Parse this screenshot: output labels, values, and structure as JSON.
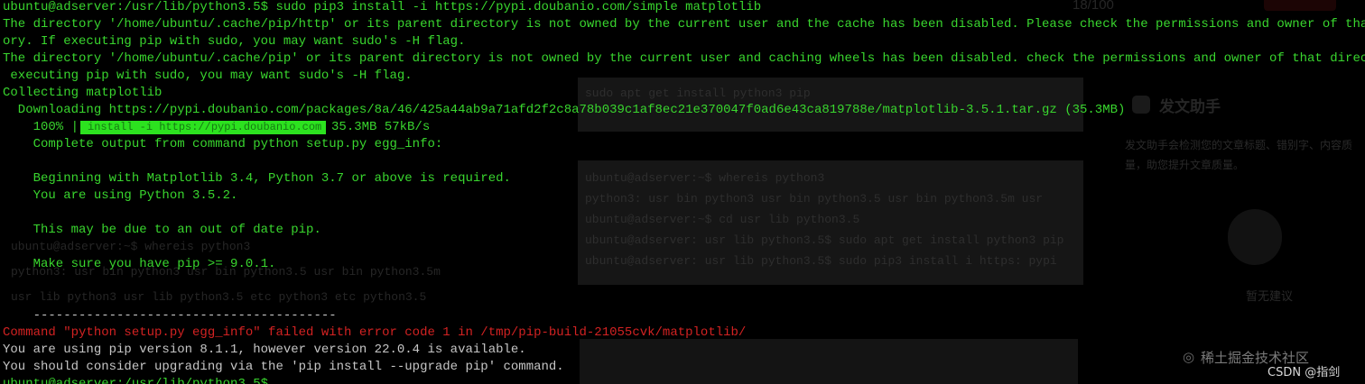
{
  "terminal": {
    "lines": [
      {
        "text": "ubuntu@adserver:/usr/lib/python3.5$ sudo pip3 install -i https://pypi.doubanio.com/simple matplotlib",
        "color": "#39d62e"
      },
      {
        "text": "The directory '/home/ubuntu/.cache/pip/http' or its parent directory is not owned by the current user and the cache has been disabled. Please check the permissions and owner of that direct",
        "color": "#39d62e"
      },
      {
        "text": "ory. If executing pip with sudo, you may want sudo's -H flag.",
        "color": "#39d62e"
      },
      {
        "text": "The directory '/home/ubuntu/.cache/pip' or its parent directory is not owned by the current user and caching wheels has been disabled. check the permissions and owner of that directo",
        "color": "#39d62e"
      },
      {
        "text": " executing pip with sudo, you may want sudo's -H flag.",
        "color": "#39d62e"
      },
      {
        "text": "Collecting matplotlib",
        "color": "#39d62e"
      },
      {
        "text": "  Downloading https://pypi.doubanio.com/packages/8a/46/425a44ab9a71afd2f2c8a78b039c1af8ec21e370047f0ad6e43ca819788e/matplotlib-3.5.1.tar.gz (35.3MB)",
        "color": "#39d62e"
      },
      {
        "text": "    Complete output from command python setup.py egg_info:",
        "color": "#39d62e"
      },
      {
        "text": "",
        "color": "#39d62e"
      },
      {
        "text": "    Beginning with Matplotlib 3.4, Python 3.7 or above is required.",
        "color": "#39d62e"
      },
      {
        "text": "    You are using Python 3.5.2.",
        "color": "#39d62e"
      },
      {
        "text": "",
        "color": "#39d62e"
      },
      {
        "text": "    This may be due to an out of date pip.",
        "color": "#39d62e"
      },
      {
        "text": "",
        "color": "#39d62e"
      },
      {
        "text": "    Make sure you have pip >= 9.0.1.",
        "color": "#39d62e"
      },
      {
        "text": "",
        "color": "#39d62e"
      },
      {
        "text": "    ----------------------------------------",
        "color": "#c6c6c6"
      },
      {
        "text": "Command \"python setup.py egg_info\" failed with error code 1 in /tmp/pip-build-21055cvk/matplotlib/",
        "color": "#d32222"
      },
      {
        "text": "You are using pip version 8.1.1, however version 22.0.4 is available.",
        "color": "#c6c6c6"
      },
      {
        "text": "You should consider upgrading via the 'pip install --upgrade pip' command.",
        "color": "#c6c6c6"
      },
      {
        "text": "ubuntu@adserver:/usr/lib/python3.5$",
        "color": "#39d62e"
      }
    ],
    "progress": {
      "percent_label": "    100% |",
      "fraction": 1.0,
      "overlay_text": "install -i https://pypi.doubanio.com",
      "size_speed": "35.3MB 57kB/s"
    }
  },
  "background_window": {
    "top_counter": "18/100",
    "code_lines_1": [
      "sudo apt get install python3 pip"
    ],
    "code_lines_2": [
      "ubuntu@adserver:~$ whereis python3",
      "python3:  usr bin python3  usr bin python3.5  usr bin python3.5m  usr",
      "ubuntu@adserver:~$ cd  usr lib python3.5",
      "ubuntu@adserver: usr lib python3.5$ sudo apt get install python3 pip",
      "ubuntu@adserver: usr lib python3.5$ sudo pip3 install  i https:  pypi"
    ],
    "left_ghost_lines": [
      "ubuntu@adserver:~$ whereis python3",
      "python3:  usr bin python3  usr bin python3.5  usr bin python3.5m",
      " usr lib python3  usr lib python3.5  etc python3  etc python3.5"
    ],
    "assistant_title": "发文助手",
    "assistant_desc": "发文助手会检测您的文章标题、错别字、内容质量，助您提升文章质量。",
    "suggest_text": "暂无建议"
  },
  "watermarks": {
    "juejin": "稀土掘金技术社区",
    "csdn": "CSDN @指剑"
  }
}
